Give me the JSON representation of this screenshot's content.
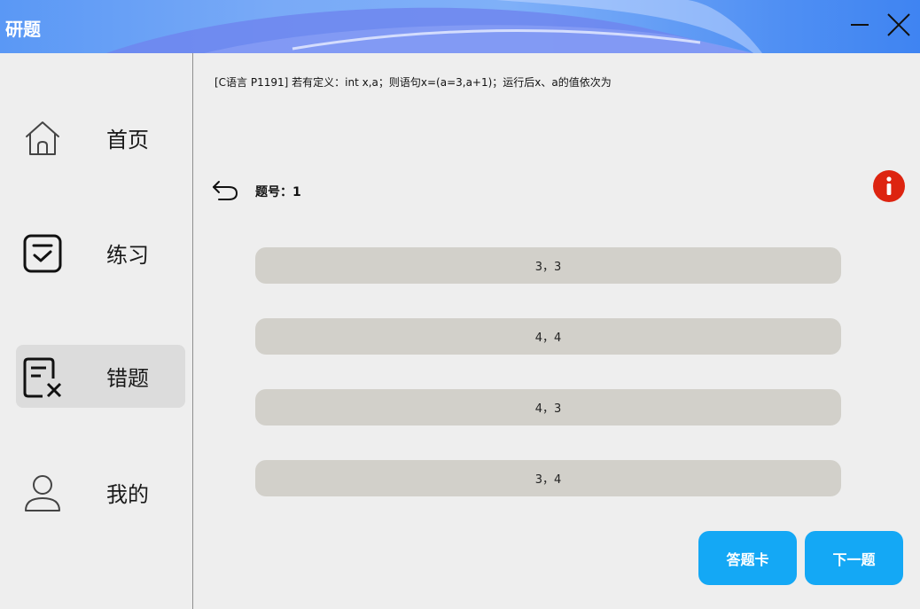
{
  "app": {
    "title": "研题"
  },
  "titlebar": {
    "minimize_icon": "minimize-icon",
    "close_icon": "close-icon",
    "accent": "#5a98f5"
  },
  "sidebar": {
    "items": [
      {
        "label": "首页",
        "icon": "home-icon",
        "active": false
      },
      {
        "label": "练习",
        "icon": "practice-check-icon",
        "active": false
      },
      {
        "label": "错题",
        "icon": "wrong-questions-icon",
        "active": true
      },
      {
        "label": "我的",
        "icon": "user-icon",
        "active": false
      }
    ]
  },
  "main": {
    "question": "[C语言 P1191] 若有定义：int x,a；则语句x=(a=3,a+1)；运行后x、a的值依次为",
    "number_label": "题号：1",
    "options": [
      "3，3",
      "4，4",
      "4，3",
      "3，4"
    ],
    "answer_card_label": "答题卡",
    "next_label": "下一题",
    "colors": {
      "option_bg": "#d2d0ca",
      "button_bg": "#14a8f5",
      "info": "#dd2410"
    }
  }
}
